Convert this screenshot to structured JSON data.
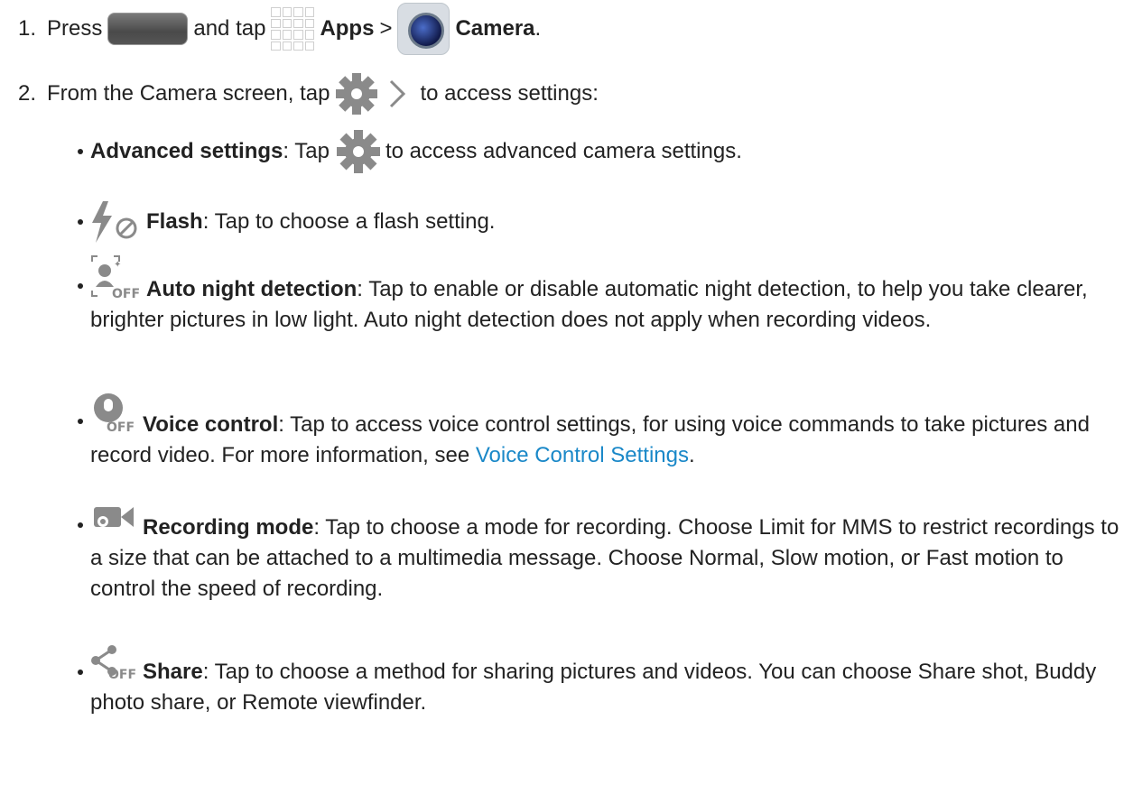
{
  "step1": {
    "num": "1.",
    "press": "Press",
    "and_tap": "and tap",
    "apps": "Apps",
    "sep": ">",
    "camera": "Camera",
    "end": ".",
    "icons": [
      "home-key-icon",
      "apps-grid-icon",
      "camera-app-icon"
    ]
  },
  "step2": {
    "num": "2.",
    "text_before": "From the Camera screen, tap",
    "text_after": "to access settings:",
    "icon": "settings-expand-icon"
  },
  "items": [
    {
      "title": "Advanced settings",
      "pre": ": Tap",
      "post": "to access advanced camera settings.",
      "icon": "gear-icon"
    },
    {
      "title": "Flash",
      "desc": ": Tap to choose a flash setting.",
      "icon": "flash-off-icon"
    },
    {
      "title": "Auto night detection",
      "desc": ": Tap to enable or disable automatic night detection, to help you take clearer, brighter pictures in low light. Auto night detection does not apply when recording videos.",
      "icon": "night-detection-off-icon"
    },
    {
      "title": "Voice control",
      "desc": ": Tap to access voice control settings, for using voice commands to take pictures and record video. For more information, see ",
      "link": "Voice Control Settings",
      "desc_end": ".",
      "icon": "voice-control-off-icon"
    },
    {
      "title": "Recording mode",
      "desc": ": Tap to choose a mode for recording. Choose Limit for MMS to restrict recordings to a size that can be attached to a multimedia message. Choose Normal, Slow motion, or Fast motion to control the speed of recording.",
      "icon": "recording-mode-icon"
    },
    {
      "title": "Share",
      "desc": ": Tap to choose a method for sharing pictures and videos. You can choose Share shot, Buddy photo share, or Remote viewfinder.",
      "icon": "share-off-icon"
    }
  ],
  "colors": {
    "text": "#222222",
    "link": "#1a88c8",
    "icon_gray": "#8a8a8a"
  }
}
